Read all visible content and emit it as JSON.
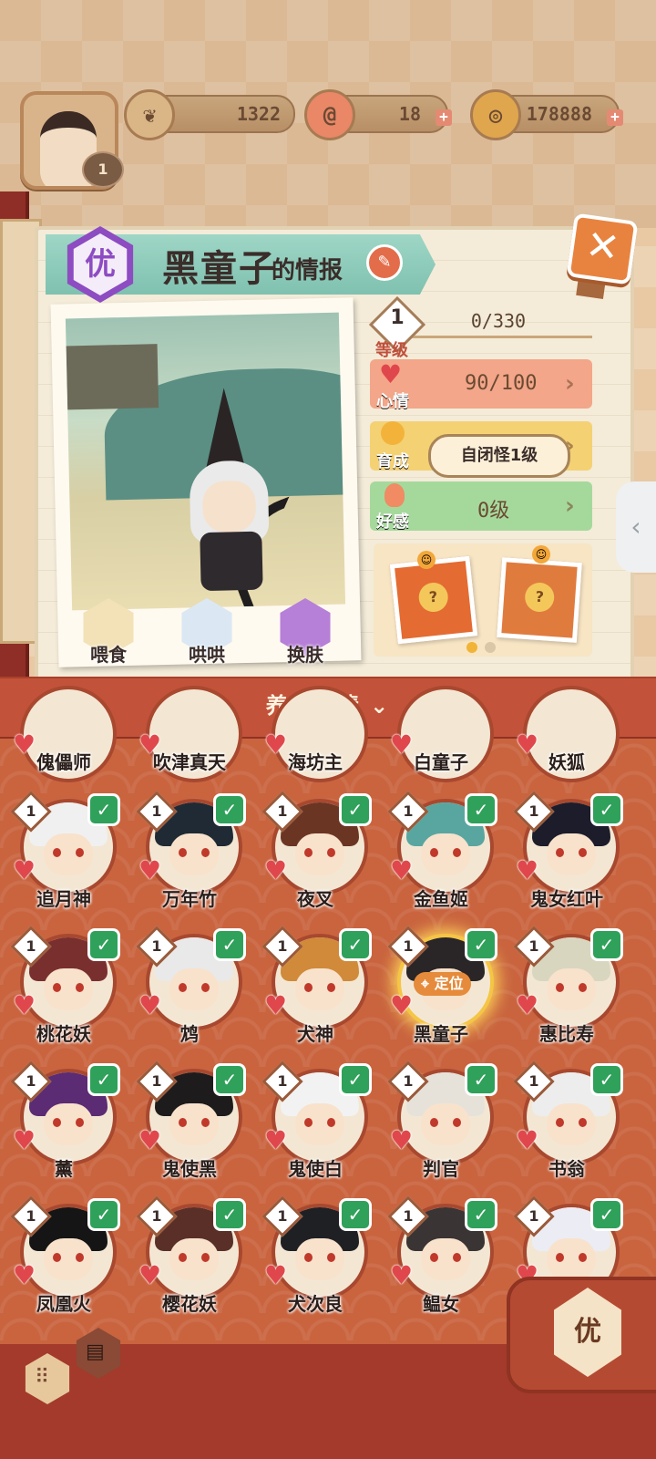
{
  "header": {
    "player_level": "1",
    "resources": [
      {
        "icon": "leaf-currency-icon",
        "value": "1322",
        "has_plus": false
      },
      {
        "icon": "spiral-stamina-icon",
        "value": "18",
        "has_plus": true
      },
      {
        "icon": "coin-icon",
        "value": "178888",
        "has_plus": true
      }
    ]
  },
  "info": {
    "rank": "优",
    "name": "黑童子",
    "title_suffix": "的情报",
    "level": "1",
    "level_label": "等级",
    "exp": "0/330",
    "mood_label": "心情",
    "mood_value": "90/100",
    "growth_label": "育成",
    "growth_value": "自闭怪1级",
    "affinity_label": "好感",
    "affinity_value": "0级"
  },
  "actions": [
    {
      "label": "喂食",
      "icon": "ramen-bowl-icon"
    },
    {
      "label": "哄哄",
      "icon": "milk-carton-icon"
    },
    {
      "label": "换肤",
      "icon": "kimono-icon"
    }
  ],
  "gift_pages": {
    "current": 1,
    "total": 2
  },
  "detail_bar": {
    "label": "养成详情"
  },
  "roster_partial": [
    "傀儡师",
    "吹津真天",
    "海坊主",
    "白童子",
    "妖狐"
  ],
  "roster": [
    {
      "name": "追月神",
      "level": "1",
      "hair": "#f0f0f0"
    },
    {
      "name": "万年竹",
      "level": "1",
      "hair": "#1f2a35"
    },
    {
      "name": "夜叉",
      "level": "1",
      "hair": "#6b3524"
    },
    {
      "name": "金鱼姬",
      "level": "1",
      "hair": "#59a6a0"
    },
    {
      "name": "鬼女红叶",
      "level": "1",
      "hair": "#1c1c2a"
    },
    {
      "name": "桃花妖",
      "level": "1",
      "hair": "#7a2f2f"
    },
    {
      "name": "鸩",
      "level": "1",
      "hair": "#e9e9e9"
    },
    {
      "name": "犬神",
      "level": "1",
      "hair": "#d08a3a"
    },
    {
      "name": "黑童子",
      "level": "1",
      "hair": "#2a2526",
      "selected": true,
      "locate_label": "定位"
    },
    {
      "name": "惠比寿",
      "level": "1",
      "hair": "#d9d6c0"
    },
    {
      "name": "薰",
      "level": "1",
      "hair": "#5b2b74"
    },
    {
      "name": "鬼使黑",
      "level": "1",
      "hair": "#1e1b1c"
    },
    {
      "name": "鬼使白",
      "level": "1",
      "hair": "#f2f2f2"
    },
    {
      "name": "判官",
      "level": "1",
      "hair": "#e6e2da"
    },
    {
      "name": "书翁",
      "level": "1",
      "hair": "#ededed"
    },
    {
      "name": "凤凰火",
      "level": "1",
      "hair": "#151515"
    },
    {
      "name": "樱花妖",
      "level": "1",
      "hair": "#5a2f28"
    },
    {
      "name": "犬次良",
      "level": "1",
      "hair": "#1f2024"
    },
    {
      "name": "鳁女",
      "level": "1",
      "hair": "#3a3434"
    },
    {
      "name": "",
      "level": "1",
      "hair": "#ececf4"
    }
  ],
  "filter": {
    "rank": "优"
  }
}
